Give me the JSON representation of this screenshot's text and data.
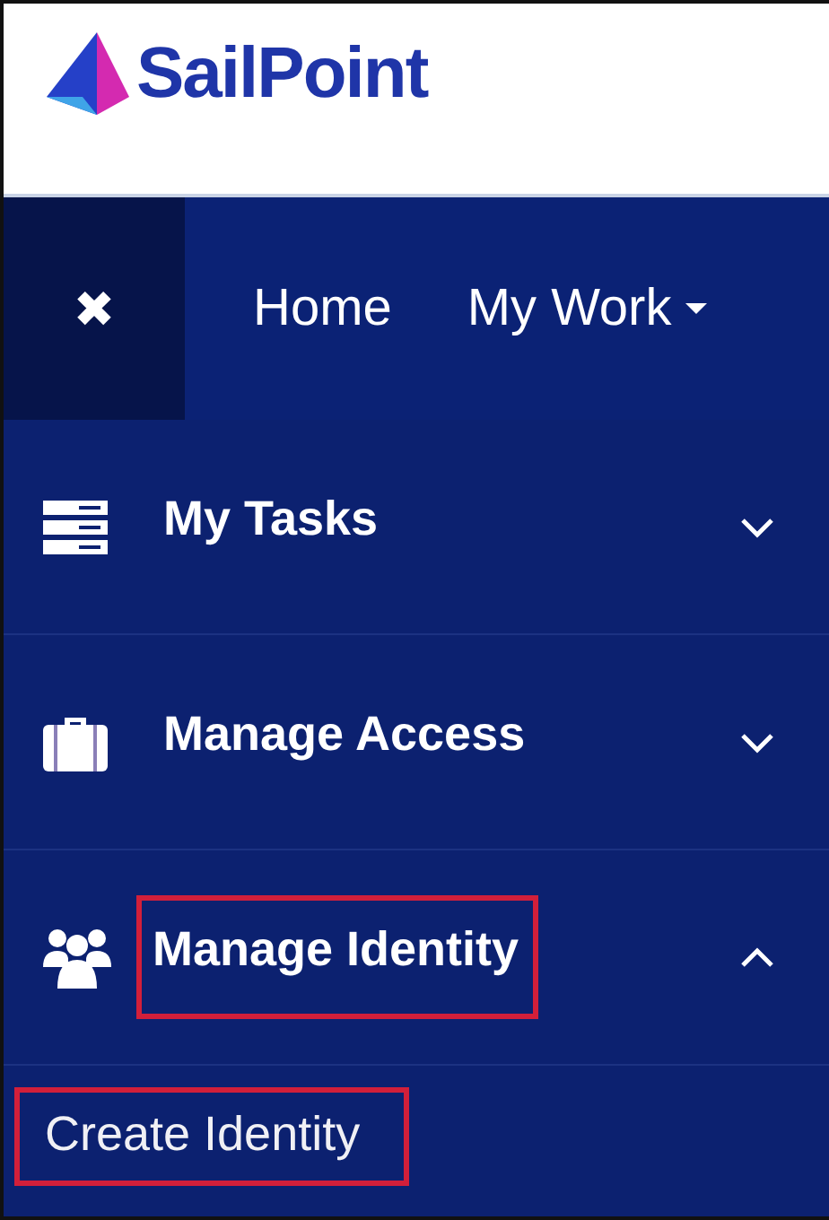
{
  "header": {
    "logo": "SailPoint"
  },
  "navbar": {
    "close": "✖",
    "links": [
      {
        "label": "Home",
        "dropdown": false
      },
      {
        "label": "My Work",
        "dropdown": true
      }
    ]
  },
  "sidebar": {
    "items": [
      {
        "label": "My Tasks",
        "kind": "tasks",
        "expanded": false,
        "highlighted": false
      },
      {
        "label": "Manage Access",
        "kind": "access",
        "expanded": false,
        "highlighted": false
      },
      {
        "label": "Manage Identity",
        "kind": "identity",
        "expanded": true,
        "highlighted": true,
        "children": [
          {
            "label": "Create Identity",
            "highlighted": true
          }
        ]
      }
    ]
  }
}
